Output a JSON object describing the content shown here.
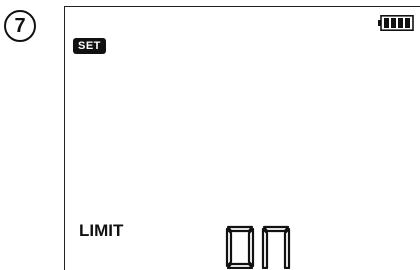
{
  "step": {
    "number": "7"
  },
  "lcd": {
    "mode_badge": "SET",
    "battery_level": 1.0,
    "parameter_label": "LIMIT",
    "value_text": "on"
  },
  "colors": {
    "ink": "#111111",
    "background": "#ffffff"
  }
}
